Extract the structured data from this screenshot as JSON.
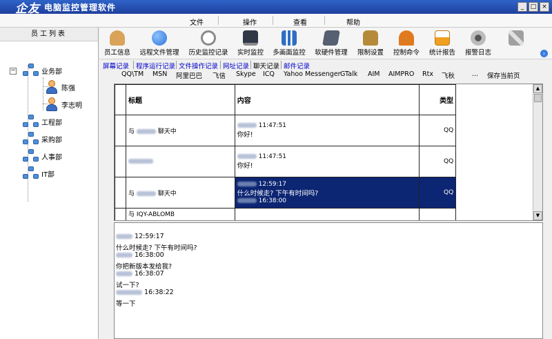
{
  "app": {
    "logo": "企友",
    "title": "电脑监控管理软件"
  },
  "window_controls": {
    "minimize": "_",
    "maximize": "□",
    "close": "×"
  },
  "menu": {
    "items": [
      "文件",
      "操作",
      "查看",
      "帮助"
    ]
  },
  "left_panel": {
    "header": "员工列表",
    "tree": [
      {
        "label": "业务部",
        "type": "group"
      },
      {
        "label": "陈强",
        "type": "user"
      },
      {
        "label": "李志明",
        "type": "user"
      },
      {
        "label": "工程部",
        "type": "group"
      },
      {
        "label": "采购部",
        "type": "group"
      },
      {
        "label": "人事部",
        "type": "group"
      },
      {
        "label": "IT部",
        "type": "group"
      }
    ]
  },
  "toolbar": {
    "items": [
      {
        "label": "员工信息",
        "icon": "person-icon",
        "color": "#d9a35a"
      },
      {
        "label": "远程文件管理",
        "icon": "globe-icon",
        "color": "#2d73d6"
      },
      {
        "label": "历史监控记录",
        "icon": "magnifier-icon",
        "color": "#c9c9c9"
      },
      {
        "label": "实时监控",
        "icon": "monitor-icon",
        "color": "#303848"
      },
      {
        "label": "多画面监控",
        "icon": "network-icon",
        "color": "#2f6fc2"
      },
      {
        "label": "软硬件管理",
        "icon": "laptop-icon",
        "color": "#556070"
      },
      {
        "label": "限制设置",
        "icon": "lock-icon",
        "color": "#b58b3a"
      },
      {
        "label": "控制命令",
        "icon": "command-icon",
        "color": "#e07a1f"
      },
      {
        "label": "统计报告",
        "icon": "chart-icon",
        "color": "#f0a020"
      },
      {
        "label": "报警日志",
        "icon": "speaker-icon",
        "color": "#9a9a9a"
      },
      {
        "label": "",
        "icon": "tools-icon",
        "color": "#a0a0a0"
      }
    ],
    "next_arrow": "›"
  },
  "subtabs": [
    "屏幕记录",
    "程序运行记录",
    "文件操作记录",
    "网址记录",
    "聊天记录",
    "邮件记录"
  ],
  "active_subtab": "聊天记录",
  "im_filters": [
    "QQ\\TM",
    "MSN",
    "阿里巴巴",
    "飞信",
    "Skype",
    "ICQ",
    "Yahoo Messenger",
    "GTalk",
    "AIM",
    "AIMPRO",
    "Rtx",
    "飞秋",
    "...",
    "保存当前页"
  ],
  "grid": {
    "headers": {
      "title": "标题",
      "content": "内容",
      "type": "类型"
    },
    "rows": [
      {
        "title_prefix": "与",
        "title_suffix": "聊天中",
        "time": "11:47:51",
        "message": "你好!",
        "type": "QQ",
        "selected": false
      },
      {
        "title_prefix": "",
        "title_suffix": "",
        "time": "11:47:51",
        "message": "你好!",
        "type": "QQ",
        "selected": false
      },
      {
        "title_prefix": "与",
        "title_suffix": "聊天中",
        "time": "12:59:17",
        "message": "什么时候走? 下午有时间吗?",
        "time2": "16:38:00",
        "type": "QQ",
        "selected": true
      },
      {
        "title_prefix": "与 IQY-ABLOMB",
        "title_suffix": "",
        "time": "",
        "message": "",
        "type": "",
        "selected": false
      }
    ]
  },
  "chat_log": [
    {
      "kind": "meta",
      "time": "12:59:17"
    },
    {
      "kind": "msg",
      "text": "什么时候走? 下午有时间吗?"
    },
    {
      "kind": "meta",
      "time": "16:38:00"
    },
    {
      "kind": "msg",
      "text": "你把新版本发给我?"
    },
    {
      "kind": "meta",
      "time": "16:38:07"
    },
    {
      "kind": "msg",
      "text": "试一下?"
    },
    {
      "kind": "meta",
      "time": "16:38:22"
    },
    {
      "kind": "msg",
      "text": "等一下"
    }
  ]
}
